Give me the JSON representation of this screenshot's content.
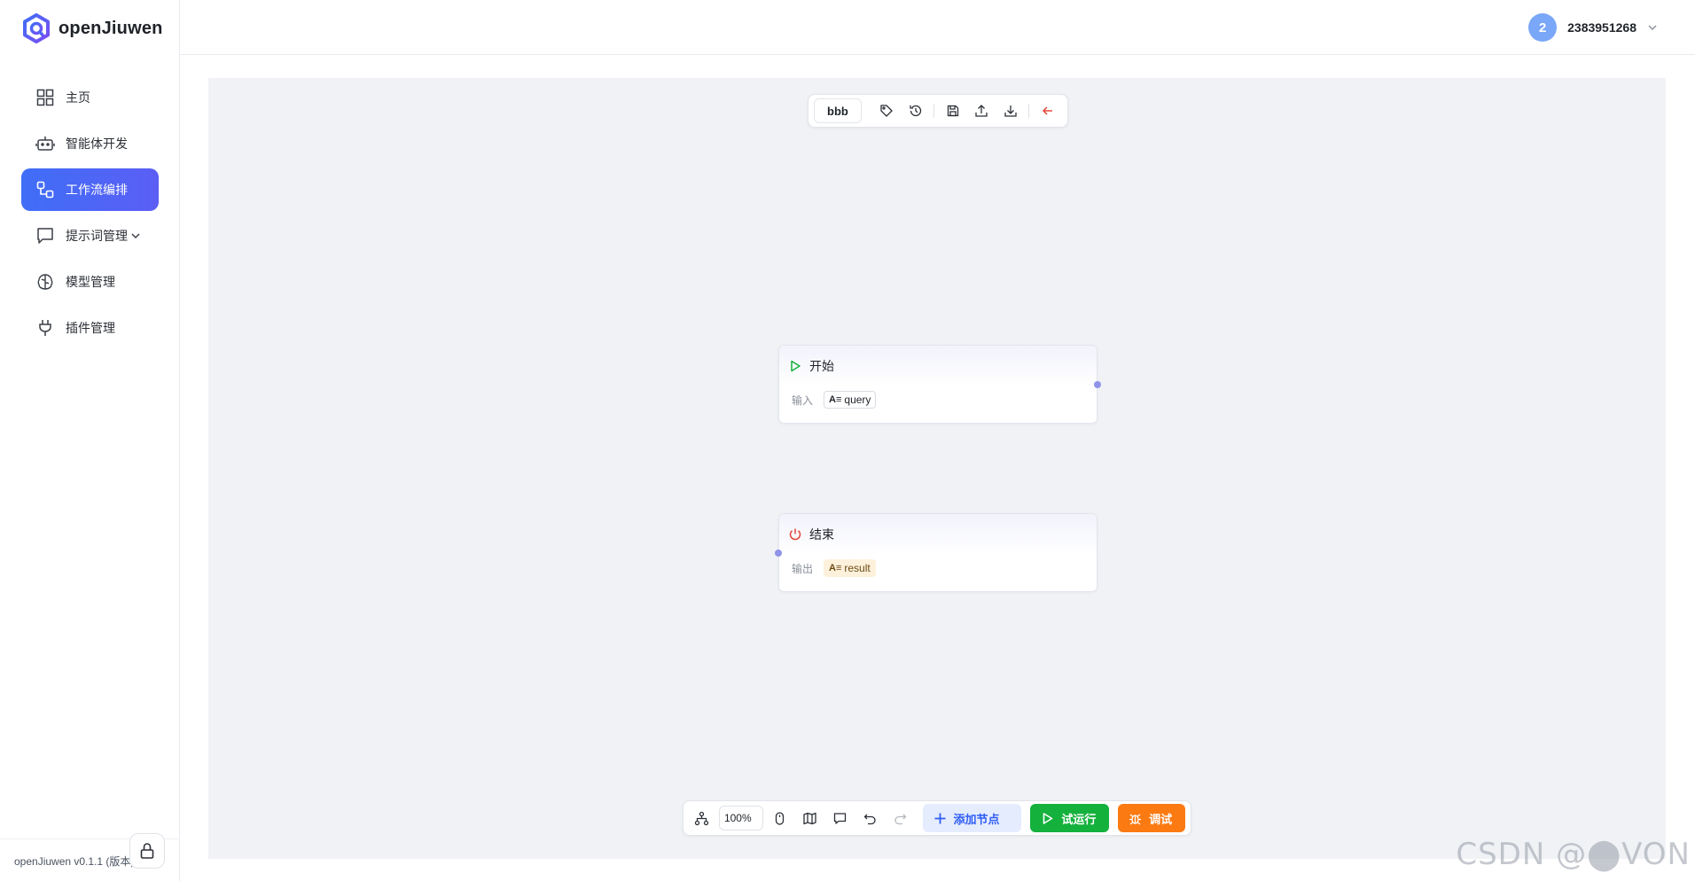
{
  "app": {
    "name": "openJiuwen",
    "version_label": "openJiuwen v0.1.1 (版本)"
  },
  "sidebar": {
    "items": [
      {
        "label": "主页",
        "icon": "dashboard-icon",
        "active": false
      },
      {
        "label": "智能体开发",
        "icon": "robot-icon",
        "active": false
      },
      {
        "label": "工作流编排",
        "icon": "workflow-icon",
        "active": true
      },
      {
        "label": "提示词管理",
        "icon": "message-icon",
        "active": false,
        "has_dropdown": true
      },
      {
        "label": "模型管理",
        "icon": "brain-icon",
        "active": false
      },
      {
        "label": "插件管理",
        "icon": "plug-icon",
        "active": false
      }
    ]
  },
  "header": {
    "user": {
      "avatar": "2",
      "name": "2383951268"
    }
  },
  "toolbar_top": {
    "workflow_name": "bbb",
    "icons": [
      "tag-icon",
      "history-icon",
      "save-icon",
      "upload-icon",
      "download-icon",
      "back-arrow-icon"
    ]
  },
  "nodes": {
    "start": {
      "title": "开始",
      "io_label": "输入",
      "var_type": "A≡",
      "var_name": "query"
    },
    "end": {
      "title": "结束",
      "io_label": "输出",
      "var_type": "A≡",
      "var_name": "result"
    }
  },
  "toolbar_bottom": {
    "zoom": "100%",
    "add_node": "添加节点",
    "trial_run": "试运行",
    "debug": "调试"
  },
  "colors": {
    "primary": "#3f6ef7",
    "run": "#14b13d",
    "debug": "#fc7a12",
    "canvas": "#f0f2f5",
    "back_arrow": "#e5483b"
  },
  "watermark": "CSDN @⬤VON"
}
